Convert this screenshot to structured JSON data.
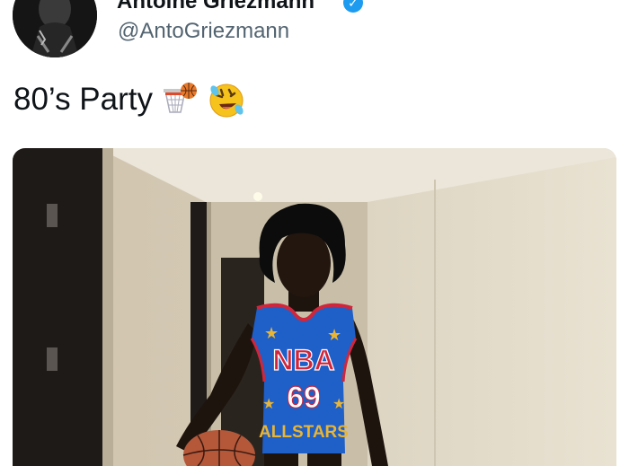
{
  "author": {
    "display_name": "Antoine Griezmann",
    "handle": "@AntoGriezmann",
    "verified": true
  },
  "tweet": {
    "text": "80’s Party",
    "emojis": [
      "basketball-hoop-icon",
      "rolling-on-floor-laughing-icon"
    ]
  },
  "media": {
    "jersey": {
      "brand_text": "NBA",
      "number": "69",
      "team_text": "ALLSTARS",
      "colors": {
        "jersey": "#1f5fc8",
        "trim": "#d0263c",
        "stars": "#e8b535"
      }
    }
  },
  "colors": {
    "text": "#0f1419",
    "secondary_text": "#536471",
    "verified_blue": "#1d9bf0"
  }
}
